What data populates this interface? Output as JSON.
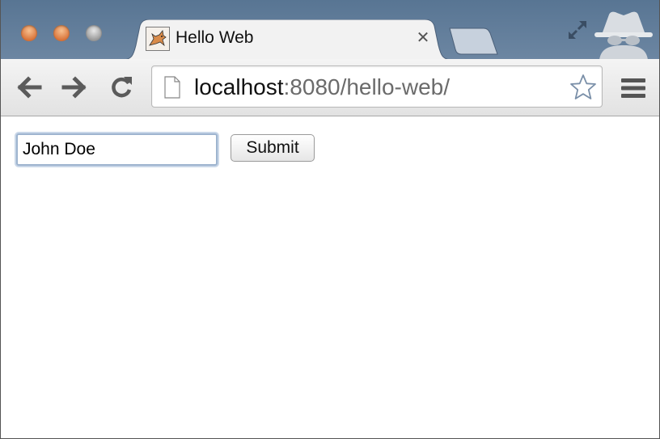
{
  "tab": {
    "title": "Hello Web",
    "favicon": "tomcat-favicon-icon",
    "close_symbol": "✕"
  },
  "address_bar": {
    "url_host": "localhost",
    "url_rest": ":8080/hello-web/"
  },
  "form": {
    "name_value": "John Doe",
    "submit_label": "Submit"
  },
  "icons": {
    "back": "back-arrow-icon",
    "forward": "forward-arrow-icon",
    "reload": "reload-icon",
    "page": "page-icon",
    "bookmark": "star-icon",
    "menu": "hamburger-menu-icon",
    "fullscreen": "fullscreen-icon",
    "incognito": "incognito-icon"
  },
  "colors": {
    "tabstrip": "#6c86a2",
    "traffic_close": "#d9743a",
    "traffic_minimize": "#d9743a",
    "traffic_maximize": "#9a9a9a"
  }
}
